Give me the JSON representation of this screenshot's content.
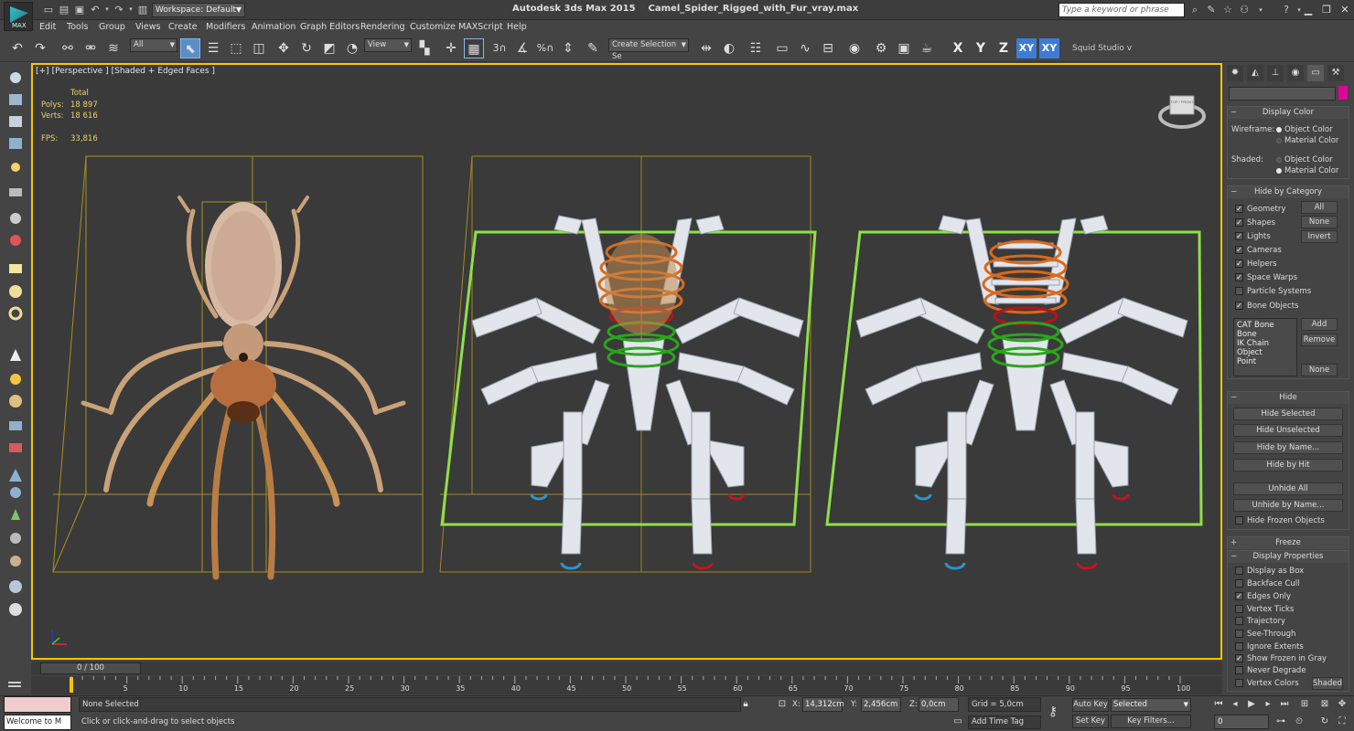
{
  "titlebar": {
    "logo_label": "MAX",
    "workspace": "Workspace: Default",
    "app_name": "Autodesk 3ds Max  2015",
    "file_name": "Camel_Spider_Rigged_with_Fur_vray.max",
    "search_placeholder": "Type a keyword or phrase"
  },
  "menu": [
    "Edit",
    "Tools",
    "Group",
    "Views",
    "Create",
    "Modifiers",
    "Animation",
    "Graph Editors",
    "Rendering",
    "Customize",
    "MAXScript",
    "Help"
  ],
  "toolbar": {
    "selection_filter": "All",
    "reference_coord": "View",
    "named_selection": "Create Selection Se",
    "snap_label": "3",
    "angle_snap_label": "%",
    "axes": [
      "X",
      "Y",
      "Z",
      "XY",
      "XY"
    ],
    "workspace_name": "Squid Studio v"
  },
  "viewport": {
    "labels": [
      "[+]",
      "[Perspective ]",
      "[Shaded + Edged Faces ]"
    ],
    "stats": {
      "total_label": "Total",
      "polys_label": "Polys:",
      "polys_value": "18 897",
      "verts_label": "Verts:",
      "verts_value": "18 616",
      "fps_label": "FPS:",
      "fps_value": "33,816"
    },
    "viewcube_label": "TOP / FRONT"
  },
  "command_panel": {
    "display_color": {
      "title": "Display Color",
      "wireframe_label": "Wireframe:",
      "shaded_label": "Shaded:",
      "object_color": "Object Color",
      "material_color": "Material Color"
    },
    "hide_by_category": {
      "title": "Hide by Category",
      "items": [
        {
          "label": "Geometry",
          "checked": true
        },
        {
          "label": "Shapes",
          "checked": true
        },
        {
          "label": "Lights",
          "checked": true
        },
        {
          "label": "Cameras",
          "checked": true
        },
        {
          "label": "Helpers",
          "checked": true
        },
        {
          "label": "Space Warps",
          "checked": true
        },
        {
          "label": "Particle Systems",
          "checked": false
        },
        {
          "label": "Bone Objects",
          "checked": true
        }
      ],
      "all_btn": "All",
      "none_btn": "None",
      "invert_btn": "Invert",
      "list": [
        "CAT Bone",
        "Bone",
        "IK Chain Object",
        "Point"
      ],
      "add_btn": "Add",
      "remove_btn": "Remove",
      "none_btn2": "None"
    },
    "hide": {
      "title": "Hide",
      "buttons": [
        "Hide Selected",
        "Hide Unselected",
        "Hide by Name...",
        "Hide by Hit",
        "Unhide All",
        "Unhide by Name..."
      ],
      "frozen_label": "Hide Frozen Objects"
    },
    "freeze": {
      "title": "Freeze"
    },
    "display_properties": {
      "title": "Display Properties",
      "items": [
        {
          "label": "Display as Box",
          "checked": false
        },
        {
          "label": "Backface Cull",
          "checked": false
        },
        {
          "label": "Edges Only",
          "checked": true
        },
        {
          "label": "Vertex Ticks",
          "checked": false
        },
        {
          "label": "Trajectory",
          "checked": false
        },
        {
          "label": "See-Through",
          "checked": false
        },
        {
          "label": "Ignore Extents",
          "checked": false
        },
        {
          "label": "Show Frozen in Gray",
          "checked": true
        },
        {
          "label": "Never Degrade",
          "checked": false
        },
        {
          "label": "Vertex Colors",
          "checked": false
        }
      ],
      "shaded_btn": "Shaded"
    }
  },
  "timeline": {
    "slider_label": "0 / 100",
    "ticks": [
      "5",
      "10",
      "15",
      "20",
      "25",
      "30",
      "35",
      "40",
      "45",
      "50",
      "55",
      "60",
      "65",
      "70",
      "75",
      "80",
      "85",
      "90",
      "95",
      "100"
    ]
  },
  "status": {
    "listener_text": "Welcome to M",
    "selection": "None Selected",
    "prompt": "Click or click-and-drag to select objects",
    "x_label": "X:",
    "x_value": "14,312cm",
    "y_label": "Y:",
    "y_value": "2,456cm",
    "z_label": "Z:",
    "z_value": "0,0cm",
    "grid": "Grid = 5,0cm",
    "add_time_tag": "Add Time Tag",
    "auto_key": "Auto Key",
    "set_key": "Set Key",
    "key_mode": "Selected",
    "key_filters": "Key Filters...",
    "frame": "0"
  },
  "colors": {
    "viewport_border": "#f5c400",
    "accent_blue": "#3d7cd6",
    "selection_green": "#8ee04a",
    "object_color": "#e1009a"
  }
}
